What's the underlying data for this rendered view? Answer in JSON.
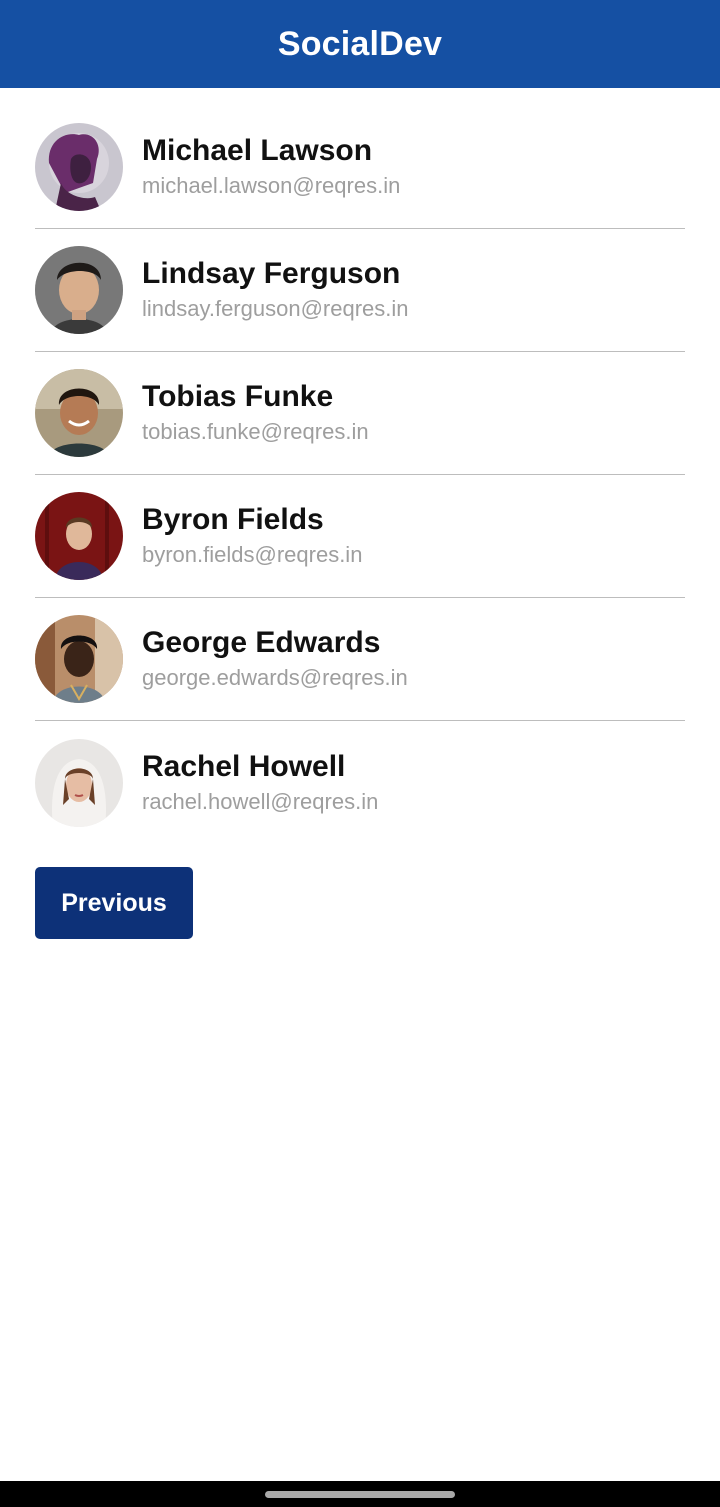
{
  "app": {
    "title": "SocialDev"
  },
  "colors": {
    "primary": "#1550a3",
    "button": "#0d3178"
  },
  "users": [
    {
      "name": "Michael Lawson",
      "email": "michael.lawson@reqres.in",
      "avatar_icon": "user-photo-purple"
    },
    {
      "name": "Lindsay Ferguson",
      "email": "lindsay.ferguson@reqres.in",
      "avatar_icon": "user-photo-gray"
    },
    {
      "name": "Tobias Funke",
      "email": "tobias.funke@reqres.in",
      "avatar_icon": "user-photo-outdoor"
    },
    {
      "name": "Byron Fields",
      "email": "byron.fields@reqres.in",
      "avatar_icon": "user-photo-red"
    },
    {
      "name": "George Edwards",
      "email": "george.edwards@reqres.in",
      "avatar_icon": "user-photo-street"
    },
    {
      "name": "Rachel Howell",
      "email": "rachel.howell@reqres.in",
      "avatar_icon": "user-photo-light"
    }
  ],
  "pagination": {
    "previous_label": "Previous"
  }
}
